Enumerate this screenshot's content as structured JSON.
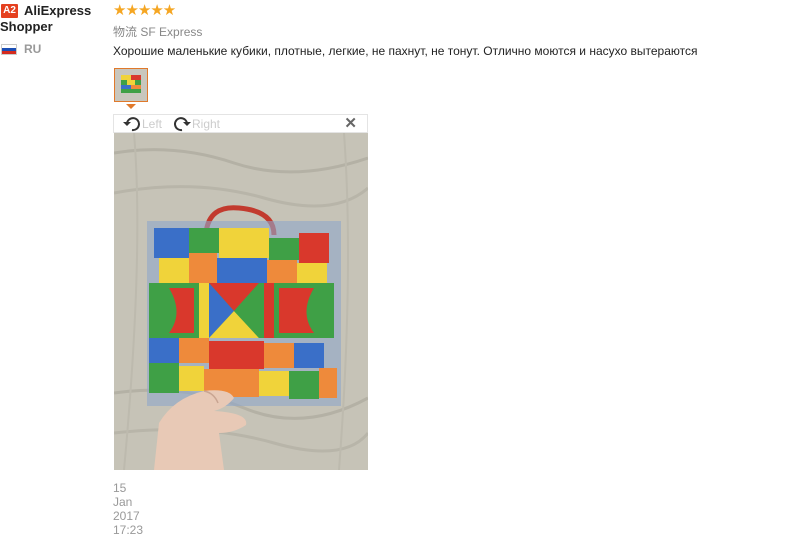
{
  "user": {
    "badge": "A2",
    "name": "AliExpress Shopper",
    "country": "RU",
    "flag_colors": [
      "#ffffff",
      "#1c4fb5",
      "#d52b1e"
    ]
  },
  "review": {
    "rating": 5,
    "stars_text": "★★★★★",
    "logistics_label": "物流",
    "logistics_value": "SF Express",
    "text": "Хорошие маленькие кубики, плотные, легкие, не пахнут, не тонут. Отлично моются и насухо вытераются",
    "date": "15 Jan 2017 17:23"
  },
  "viewer": {
    "rotate_left_label": "Left",
    "rotate_right_label": "Right",
    "close_symbol": "✕"
  },
  "colors": {
    "accent": "#e0792b",
    "star": "#f5a623",
    "badge": "#e5401f"
  }
}
